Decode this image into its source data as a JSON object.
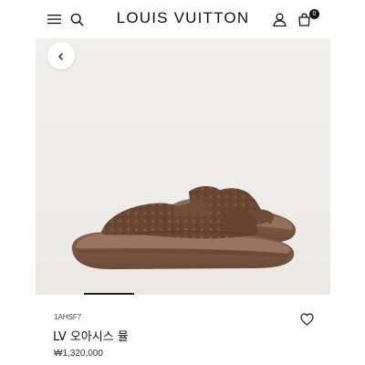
{
  "header": {
    "brand": "LOUIS VUITTON",
    "cart_count": "0",
    "icons": [
      "menu-icon",
      "search-icon",
      "account-icon",
      "shopping-bag-icon"
    ]
  },
  "gallery": {
    "back_icon": "chevron-left-icon",
    "image_subject": "brown suede slide sandals with monogram pattern"
  },
  "product": {
    "sku": "1AHSF7",
    "name": "LV 오아시스 뮬",
    "price": "₩1,320,000",
    "wishlist_icon": "heart-outline-icon"
  },
  "colors": {
    "brand_text": "#111111",
    "leather_brown": "#6b4a37",
    "sole_brown": "#7a5540",
    "background": "#ffffff"
  }
}
